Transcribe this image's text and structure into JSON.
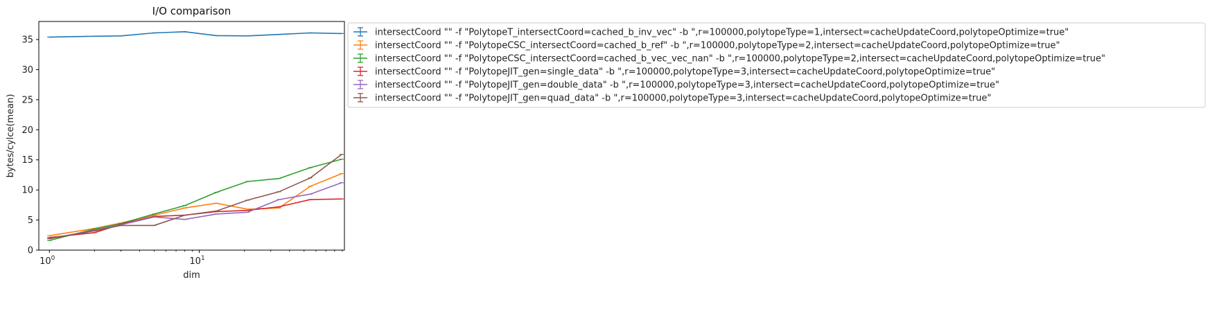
{
  "chart_data": {
    "type": "line",
    "title": "I/O comparison",
    "xlabel": "dim",
    "ylabel": "bytes/cylce(mean)",
    "xscale": "log",
    "xlim": [
      0.85,
      93
    ],
    "ylim": [
      0,
      38
    ],
    "x_ticks": [
      {
        "value": 1,
        "base": "10",
        "exp": "0"
      },
      {
        "value": 10,
        "base": "10",
        "exp": "1"
      }
    ],
    "y_ticks": [
      0,
      5,
      10,
      15,
      20,
      25,
      30,
      35
    ],
    "grid": false,
    "legend_position": "outside-right",
    "x": [
      1,
      2,
      3,
      5,
      8,
      13,
      21,
      34,
      55,
      89
    ],
    "series": [
      {
        "name": "intersectCoord \"\" -f \"PolytopeT_intersectCoord=cached_b_inv_vec\" -b \",r=100000,polytopeType=1,intersect=cacheUpdateCoord,polytopeOptimize=true\"",
        "color": "#1f77b4",
        "values": [
          35.4,
          35.55,
          35.6,
          36.1,
          36.3,
          35.65,
          35.6,
          35.85,
          36.1,
          36.0
        ]
      },
      {
        "name": "intersectCoord \"\" -f \"PolytopeCSC_intersectCoord=cached_b_ref\" -b \",r=100000,polytopeType=2,intersect=cacheUpdateCoord,polytopeOptimize=true\"",
        "color": "#ff7f0e",
        "values": [
          2.4,
          3.6,
          4.5,
          5.8,
          7.0,
          7.8,
          6.8,
          7.0,
          10.6,
          12.7
        ]
      },
      {
        "name": "intersectCoord \"\" -f \"PolytopeCSC_intersectCoord=cached_b_vec_vec_nan\" -b \",r=100000,polytopeType=2,intersect=cacheUpdateCoord,polytopeOptimize=true\"",
        "color": "#2ca02c",
        "values": [
          1.6,
          3.5,
          4.4,
          6.0,
          7.4,
          9.6,
          11.4,
          11.9,
          13.7,
          15.1
        ]
      },
      {
        "name": "intersectCoord \"\" -f \"PolytopeJIT_gen=single_data\" -b \",r=100000,polytopeType=3,intersect=cacheUpdateCoord,polytopeOptimize=true\"",
        "color": "#d62728",
        "values": [
          2.1,
          2.9,
          4.3,
          5.6,
          5.8,
          6.4,
          6.6,
          7.2,
          8.4,
          8.5
        ]
      },
      {
        "name": "intersectCoord \"\" -f \"PolytopeJIT_gen=double_data\" -b \",r=100000,polytopeType=3,intersect=cacheUpdateCoord,polytopeOptimize=true\"",
        "color": "#9467bd",
        "values": [
          1.9,
          3.3,
          4.2,
          5.5,
          5.1,
          6.0,
          6.3,
          8.4,
          9.3,
          11.2
        ]
      },
      {
        "name": "intersectCoord \"\" -f \"PolytopeJIT_gen=quad_data\" -b \",r=100000,polytopeType=3,intersect=cacheUpdateCoord,polytopeOptimize=true\"",
        "color": "#8c564b",
        "values": [
          1.9,
          3.2,
          4.1,
          4.1,
          5.8,
          6.5,
          8.3,
          9.7,
          12.0,
          15.9
        ]
      }
    ]
  }
}
